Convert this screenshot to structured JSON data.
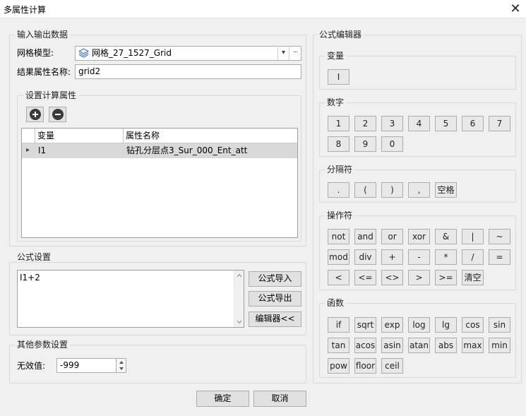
{
  "window": {
    "title": "多属性计算",
    "close_glyph": "✕"
  },
  "io": {
    "group_label": "输入输出数据",
    "grid_label": "网格模型:",
    "grid_value": "网格_27_1527_Grid",
    "result_label": "结果属性名称:",
    "result_value": "grid2",
    "dropdown_glyph": "▾",
    "more_glyph": "···"
  },
  "calc_attrs": {
    "group_label": "设置计算属性",
    "columns": [
      "变量",
      "属性名称"
    ],
    "rows": [
      {
        "marker": "▸",
        "var": "I1",
        "attr": "钻孔分层点3_Sur_000_Ent_att"
      }
    ]
  },
  "formula": {
    "group_label": "公式设置",
    "text": "I1+2",
    "import_label": "公式导入",
    "export_label": "公式导出",
    "editor_label": "编辑器<<"
  },
  "other": {
    "group_label": "其他参数设置",
    "invalid_label": "无效值:",
    "invalid_value": "-999"
  },
  "footer": {
    "ok_label": "确定",
    "cancel_label": "取消"
  },
  "editor": {
    "group_label": "公式编辑器",
    "variables": {
      "label": "变量",
      "items": [
        "I"
      ]
    },
    "digits": {
      "label": "数字",
      "items": [
        "1",
        "2",
        "3",
        "4",
        "5",
        "6",
        "7",
        "8",
        "9",
        "0"
      ]
    },
    "separators": {
      "label": "分隔符",
      "items": [
        ".",
        "(",
        ")",
        ",",
        "空格"
      ]
    },
    "operators": {
      "label": "操作符",
      "items": [
        "not",
        "and",
        "or",
        "xor",
        "&",
        "|",
        "~",
        "mod",
        "div",
        "+",
        "-",
        "*",
        "/",
        "=",
        "<",
        "<=",
        "<>",
        ">",
        ">=",
        "清空"
      ]
    },
    "functions": {
      "label": "函数",
      "items": [
        "if",
        "sqrt",
        "exp",
        "log",
        "lg",
        "cos",
        "sin",
        "tan",
        "acos",
        "asin",
        "atan",
        "abs",
        "max",
        "min",
        "pow",
        "floor",
        "ceil"
      ]
    }
  }
}
